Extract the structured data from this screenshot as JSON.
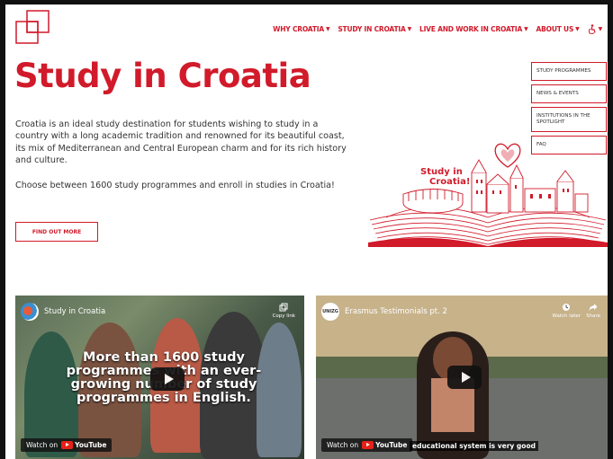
{
  "nav": {
    "items": [
      {
        "label": "WHY CROATIA"
      },
      {
        "label": "STUDY IN CROATIA"
      },
      {
        "label": "LIVE AND WORK IN CROATIA"
      },
      {
        "label": "ABOUT US"
      }
    ],
    "accessibility_icon": "accessibility-icon"
  },
  "hero": {
    "title": "Study in Croatia",
    "intro": "Croatia is an ideal study destination for students wishing to study in a country with a long academic tradition and renowned for its beautiful coast, its mix of Mediterranean and Central European charm and for its rich history and culture.",
    "choose": "Choose between 1600 study programmes and enroll in studies in Croatia!",
    "cta_label": "FIND OUT MORE"
  },
  "side_menu": [
    {
      "label": "STUDY PROGRAMMES"
    },
    {
      "label": "NEWS & EVENTS"
    },
    {
      "label": "INSTITUTIONS IN THE SPOTLIGHT"
    },
    {
      "label": "FAQ"
    }
  ],
  "illustration": {
    "label_line1": "Study in",
    "label_line2": "Croatia!"
  },
  "videos": [
    {
      "title": "Study in Croatia",
      "action": "Copy link",
      "overlay": "More than 1600 study programmes with an ever-growing number of study programmes in English.",
      "watch_label": "Watch on",
      "platform": "YouTube"
    },
    {
      "title": "Erasmus Testimonials pt. 2",
      "channel_initials": "UNIZG",
      "actions": [
        "Watch later",
        "Share"
      ],
      "caption": "educational system is very good",
      "watch_label": "Watch on",
      "platform": "YouTube"
    }
  ],
  "colors": {
    "accent": "#d11a2a"
  }
}
